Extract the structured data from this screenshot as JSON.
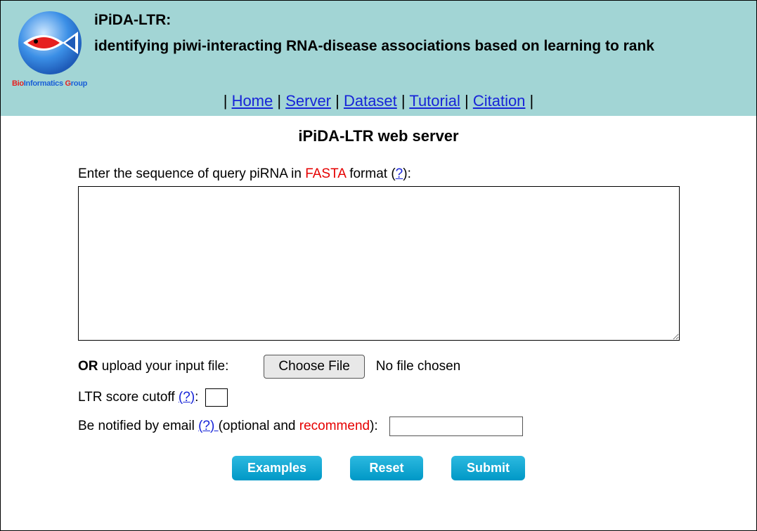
{
  "header": {
    "logo_text_parts": [
      "Bio",
      "Informatics ",
      "G",
      "roup"
    ],
    "title1": "iPiDA-LTR:",
    "title2": "identifying piwi-interacting RNA-disease associations based on learning to rank"
  },
  "nav": {
    "items": [
      "Home",
      "Server",
      "Dataset",
      "Tutorial",
      "Citation"
    ]
  },
  "main": {
    "page_title": "iPiDA-LTR web server",
    "seq_label_pre": "Enter the sequence of query piRNA in ",
    "seq_label_fasta": "FASTA",
    "seq_label_post": " format (",
    "help_q": "?",
    "seq_label_close": "):",
    "seq_value": "",
    "upload_or": "OR",
    "upload_label": " upload your input file:",
    "choose_file": "Choose File",
    "file_status": "No file chosen",
    "cutoff_label_pre": "LTR score cutoff ",
    "cutoff_label_post": ":",
    "cutoff_value": "",
    "email_label_pre": "Be notified by email ",
    "email_label_mid": "(optional and ",
    "email_recommend": "recommend",
    "email_label_post": "):",
    "email_value": "",
    "buttons": {
      "examples": "Examples",
      "reset": "Reset",
      "submit": "Submit"
    }
  }
}
